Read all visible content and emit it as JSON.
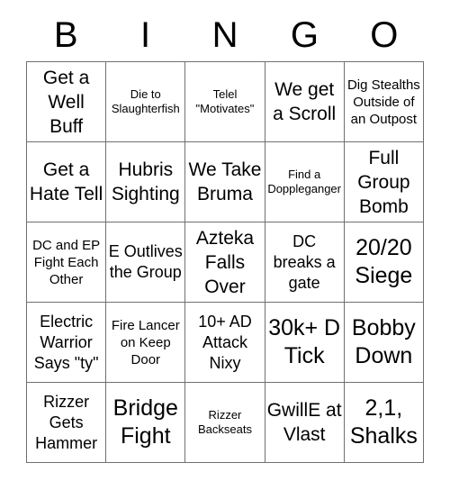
{
  "card": {
    "title": "BINGO",
    "columns": [
      "B",
      "I",
      "N",
      "G",
      "O"
    ],
    "border_color": "#707070",
    "background_color": "#ffffff",
    "text_color": "#000000",
    "rows": [
      [
        {
          "text": "Get a Well Buff",
          "size": "xl"
        },
        {
          "text": "Die to Slaughterfish",
          "size": "s"
        },
        {
          "text": "Telel \"Motivates\"",
          "size": "s"
        },
        {
          "text": "We get a Scroll",
          "size": "xl"
        },
        {
          "text": "Dig Stealths Outside of an Outpost",
          "size": "m"
        }
      ],
      [
        {
          "text": "Get a Hate Tell",
          "size": "xl"
        },
        {
          "text": "Hubris Sighting",
          "size": "xl"
        },
        {
          "text": "We Take Bruma",
          "size": "xl"
        },
        {
          "text": "Find a Doppleganger",
          "size": "s"
        },
        {
          "text": "Full Group Bomb",
          "size": "xl"
        }
      ],
      [
        {
          "text": "DC and EP Fight Each Other",
          "size": "m"
        },
        {
          "text": "E Outlives the Group",
          "size": "l"
        },
        {
          "text": "Azteka Falls Over",
          "size": "xl"
        },
        {
          "text": "DC breaks a gate",
          "size": "l"
        },
        {
          "text": "20/20 Siege",
          "size": "xxl"
        }
      ],
      [
        {
          "text": "Electric Warrior Says \"ty\"",
          "size": "l"
        },
        {
          "text": "Fire Lancer on Keep Door",
          "size": "m"
        },
        {
          "text": "10+ AD Attack Nixy",
          "size": "l"
        },
        {
          "text": "30k+ D Tick",
          "size": "xxl"
        },
        {
          "text": "Bobby Down",
          "size": "xxl"
        }
      ],
      [
        {
          "text": "Rizzer Gets Hammer",
          "size": "l"
        },
        {
          "text": "Bridge Fight",
          "size": "xxl"
        },
        {
          "text": "Rizzer Backseats",
          "size": "s"
        },
        {
          "text": "GwillE at Vlast",
          "size": "xl"
        },
        {
          "text": "2,1, Shalks",
          "size": "xxl"
        }
      ]
    ]
  }
}
